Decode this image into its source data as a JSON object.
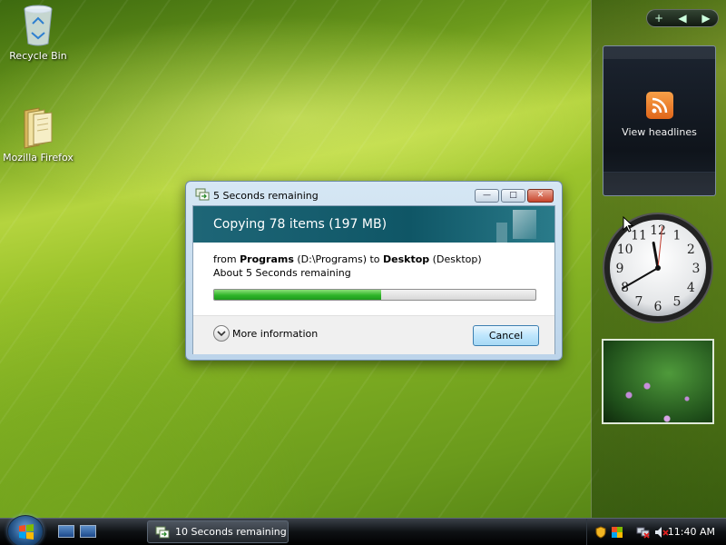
{
  "desktop": {
    "icons": [
      {
        "label": "Recycle Bin",
        "icon": "recycle-bin-icon"
      },
      {
        "label": "Mozilla Firefox",
        "icon": "folder-icon"
      }
    ]
  },
  "sidebar": {
    "controls": [
      "+",
      "◀",
      "▶"
    ],
    "feed_gadget": {
      "label": "View headlines",
      "icon": "rss-icon"
    },
    "clock_gadget": {
      "numbers": [
        "12",
        "1",
        "2",
        "3",
        "4",
        "5",
        "6",
        "7",
        "8",
        "9",
        "10",
        "11"
      ],
      "time": {
        "hour": 11,
        "minute": 40,
        "second": 1
      }
    },
    "photo_gadget": {
      "subject": "flowers"
    }
  },
  "dialog": {
    "title": "5 Seconds remaining",
    "heading": "Copying 78 items (197 MB)",
    "from_prefix": "from ",
    "source_name": "Programs",
    "source_path": " (D:\\Programs) to ",
    "dest_name": "Desktop",
    "dest_path": " (Desktop)",
    "time_remaining": "About 5 Seconds remaining",
    "progress_fraction": 0.52,
    "more_info_label": "More information",
    "cancel_label": "Cancel",
    "window_buttons": {
      "minimize": "—",
      "maximize": "□",
      "close": "✕"
    }
  },
  "taskbar": {
    "task_label": "10 Seconds remaining",
    "clock": "11:40 AM"
  },
  "colors": {
    "accent_banner": "#0f5666",
    "progress_green": "#2fb52a",
    "taskbar": "#0e1114"
  }
}
